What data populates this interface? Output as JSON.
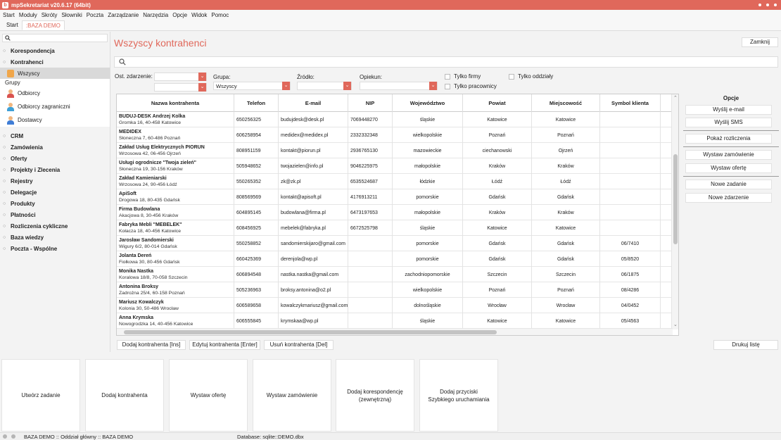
{
  "window": {
    "title": "mpSekretariat v20.6.17 (64bit)"
  },
  "menu": [
    "Start",
    "Moduły",
    "Skróty",
    "Słowniki",
    "Poczta",
    "Zarządzanie",
    "Narzędzia",
    "Opcje",
    "Widok",
    "Pomoc"
  ],
  "tabs": [
    "Start",
    ":BAZA DEMO"
  ],
  "sidebar": {
    "sections_top": [
      "Korespondencja",
      "Kontrahenci"
    ],
    "selected_item": "Wszyscy",
    "groups_label": "Grupy",
    "groups": [
      "Odbiorcy",
      "Odbiorcy zagraniczni",
      "Dostawcy"
    ],
    "sections_bottom": [
      "CRM",
      "Zamówienia",
      "Oferty",
      "Projekty i Zlecenia",
      "Rejestry",
      "Delegacje",
      "Produkty",
      "Płatności",
      "Rozliczenia cykliczne",
      "Baza wiedzy",
      "Poczta - Wspólne"
    ]
  },
  "main": {
    "title": "Wszyscy kontrahenci",
    "close_label": "Zamknij"
  },
  "filters": {
    "ost_zdarzenie_label": "Ost. zdarzenie:",
    "grupa_label": "Grupa:",
    "grupa_value": "Wszyscy",
    "zrodlo_label": "Źródło:",
    "opiekun_label": "Opiekun:",
    "tylko_firmy": "Tylko firmy",
    "tylko_oddzialy": "Tylko oddziały",
    "tylko_pracownicy": "Tylko pracownicy"
  },
  "table": {
    "columns": [
      "Nazwa kontrahenta",
      "Telefon",
      "E-mail",
      "NIP",
      "Województwo",
      "Powiat",
      "Miejscowość",
      "Symbol klienta"
    ],
    "rows": [
      {
        "name": "BUDUJ-DESK Andrzej Kolka",
        "addr": "Gromka 16, 40-458 Katowice",
        "tel": "650256325",
        "email": "budujdesk@desk.pl",
        "nip": "7069448270",
        "woj": "śląskie",
        "powiat": "Katowice",
        "miasto": "Katowice",
        "symbol": ""
      },
      {
        "name": "MEDIDEX",
        "addr": "Słoneczna 7, 60-486 Poznań",
        "tel": "606258954",
        "email": "medidex@medidex.pl",
        "nip": "2332332348",
        "woj": "wielkopolskie",
        "powiat": "Poznań",
        "miasto": "Poznań",
        "symbol": ""
      },
      {
        "name": "Zakład Usług Elektrycznych PIORUN",
        "addr": "Wrzosowa 42, 06-456 Ojrzeń",
        "tel": "808951159",
        "email": "kontakt@piorun.pl",
        "nip": "2936765130",
        "woj": "mazowieckie",
        "powiat": "ciechanowski",
        "miasto": "Ojrzeń",
        "symbol": ""
      },
      {
        "name": "Usługi ogrodnicze \"Twoja zieleń\"",
        "addr": "Słoneczna 19, 30-156 Kraków",
        "tel": "505948652",
        "email": "twojazielen@info.pl",
        "nip": "9046225975",
        "woj": "małopolskie",
        "powiat": "Kraków",
        "miasto": "Kraków",
        "symbol": ""
      },
      {
        "name": "Zakład Kamieniarski",
        "addr": "Wrzosowa 24, 90-456 Łódź",
        "tel": "550265352",
        "email": "zk@zk.pl",
        "nip": "6535524687",
        "woj": "łódzkie",
        "powiat": "Łódź",
        "miasto": "Łódź",
        "symbol": ""
      },
      {
        "name": "ApiSoft",
        "addr": "Drogowa 18, 80-435 Gdańsk",
        "tel": "808569569",
        "email": "kontakt@apisoft.pl",
        "nip": "4176913211",
        "woj": "pomorskie",
        "powiat": "Gdańsk",
        "miasto": "Gdańsk",
        "symbol": ""
      },
      {
        "name": "Firma Budowlana",
        "addr": "Akacjowa 8, 30-456 Kraków",
        "tel": "604895145",
        "email": "budowlana@firma.pl",
        "nip": "6473197653",
        "woj": "małopolskie",
        "powiat": "Kraków",
        "miasto": "Kraków",
        "symbol": ""
      },
      {
        "name": "Fabryka Mebli \"MEBELEK\"",
        "addr": "Kołacza 18, 40-456 Katowice",
        "tel": "608456925",
        "email": "mebelek@fabryka.pl",
        "nip": "6672525798",
        "woj": "śląskie",
        "powiat": "Katowice",
        "miasto": "Katowice",
        "symbol": ""
      },
      {
        "name": "Jarosław Sandomierski",
        "addr": "Wigury 6/2, 80-014 Gdańsk",
        "tel": "550258852",
        "email": "sandomierskijaro@gmail.com",
        "nip": "",
        "woj": "pomorskie",
        "powiat": "Gdańsk",
        "miasto": "Gdańsk",
        "symbol": "06/7410"
      },
      {
        "name": "Jolanta Dereń",
        "addr": "Fiołkowa 30, 80-456 Gdańsk",
        "tel": "660425369",
        "email": "derenjola@wp.pl",
        "nip": "",
        "woj": "pomorskie",
        "powiat": "Gdańsk",
        "miasto": "Gdańsk",
        "symbol": "05/8520"
      },
      {
        "name": "Monika Nastka",
        "addr": "Koralowa 18/8, 70-058 Szczecin",
        "tel": "606894548",
        "email": "nastka.nastka@gmail.com",
        "nip": "",
        "woj": "zachodniopomorskie",
        "powiat": "Szczecin",
        "miasto": "Szczecin",
        "symbol": "06/1875"
      },
      {
        "name": "Antonina Broksy",
        "addr": "Zadrożna 25/4, 60-158 Poznań",
        "tel": "505236963",
        "email": "broksy.antonina@o2.pl",
        "nip": "",
        "woj": "wielkopolskie",
        "powiat": "Poznań",
        "miasto": "Poznań",
        "symbol": "08/4286"
      },
      {
        "name": "Mariusz Kowalczyk",
        "addr": "Kolonia 30, 50-486 Wrocław",
        "tel": "606589658",
        "email": "kowalczykmariusz@gmail.com",
        "nip": "",
        "woj": "dolnośląskie",
        "powiat": "Wrocław",
        "miasto": "Wrocław",
        "symbol": "04/0452"
      },
      {
        "name": "Anna Krymska",
        "addr": "Nowogrodzka 14, 40-456 Katowice",
        "tel": "606555845",
        "email": "krymskaa@wp.pl",
        "nip": "",
        "woj": "śląskie",
        "powiat": "Katowice",
        "miasto": "Katowice",
        "symbol": "05/4563"
      }
    ]
  },
  "options": {
    "header": "Opcje",
    "wyslij_email": "Wyślij e-mail",
    "wyslij_sms": "Wyślij SMS",
    "pokaz_rozliczenia": "Pokaż rozliczenia",
    "wystaw_zamowienie": "Wystaw zamówienie",
    "wystaw_oferte": "Wystaw ofertę",
    "nowe_zadanie": "Nowe zadanie",
    "nowe_zdarzenie": "Nowe zdarzenie"
  },
  "actions": {
    "dodaj": "Dodaj kontrahenta [Ins]",
    "edytuj": "Edytuj kontrahenta [Enter]",
    "usun": "Usuń kontrahenta [Del]",
    "drukuj": "Drukuj listę"
  },
  "quick": {
    "utworz_zadanie": "Utwórz zadanie",
    "dodaj_kontrahenta": "Dodaj kontrahenta",
    "wystaw_oferte": "Wystaw ofertę",
    "wystaw_zamowienie": "Wystaw zamówienie",
    "dodaj_koresp_1": "Dodaj korespondencję",
    "dodaj_koresp_2": "(zewnętrzną)",
    "dodaj_przyciski_1": "Dodaj przyciski",
    "dodaj_przyciski_2": "Szybkiego uruchamiania"
  },
  "status": {
    "left": "BAZA DEMO :: Oddział główny :: BAZA DEMO",
    "db": "Database: sqlite::DEMO.dbx"
  },
  "colors": {
    "accent": "#e0685b"
  }
}
